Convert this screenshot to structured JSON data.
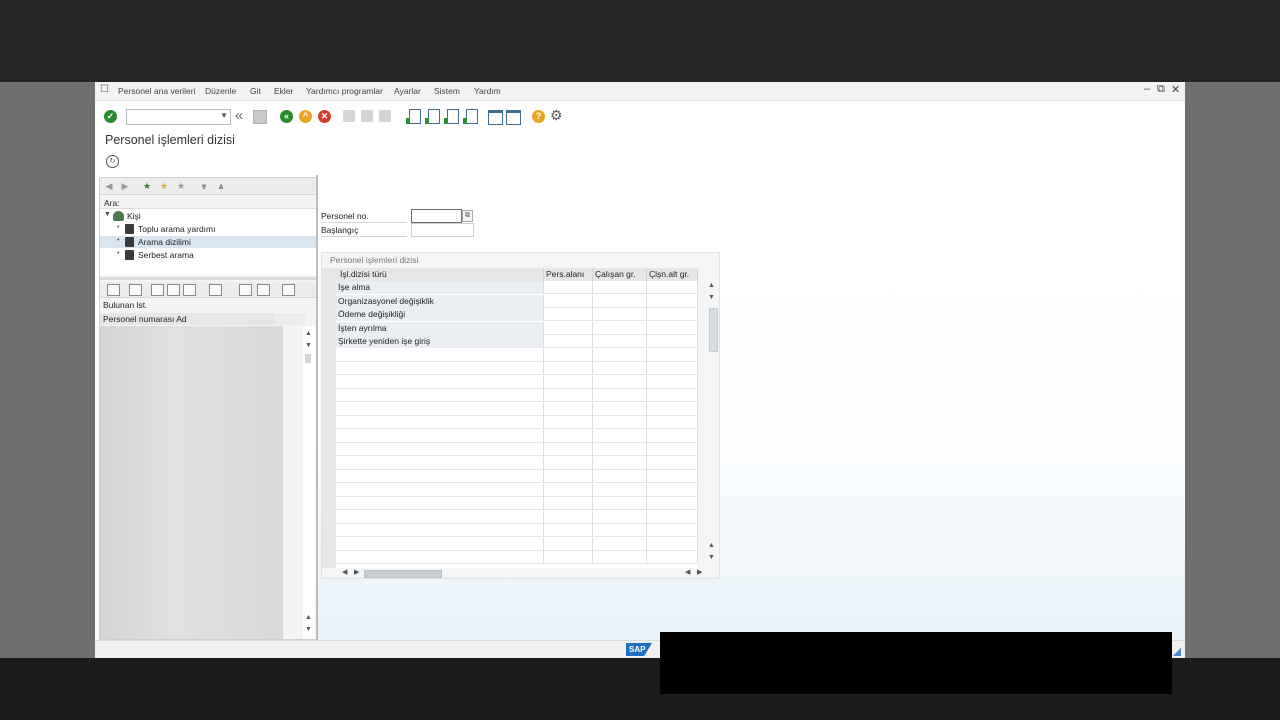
{
  "menu": {
    "items": [
      "Personel ana verileri",
      "Düzenle",
      "Git",
      "Ekler",
      "Yardımcı programlar",
      "Ayarlar",
      "Sistem",
      "Yardım"
    ]
  },
  "toolbar": {
    "command_value": "",
    "icons": [
      "enter-icon",
      "back-icon",
      "exit-icon",
      "cancel-icon",
      "print-icon",
      "find-icon",
      "find-next-icon",
      "first-page-icon",
      "previous-page-icon",
      "next-page-icon",
      "last-page-icon",
      "new-session-icon",
      "shortcut-icon",
      "help-icon",
      "customize-icon"
    ]
  },
  "page": {
    "title": "Personel işlemleri dizisi"
  },
  "left_panel": {
    "search_label": "Ara:",
    "tree": [
      {
        "label": "Kişi",
        "selected": false
      },
      {
        "label": "Toplu arama yardımı",
        "selected": false
      },
      {
        "label": "Arama dizilimi",
        "selected": true
      },
      {
        "label": "Serbest arama",
        "selected": false
      }
    ],
    "found_label": "Bulunan lst.",
    "result_header": "Personel numarası Ad"
  },
  "form": {
    "personnel_no_label": "Personel no.",
    "personnel_no_value": "",
    "start_label": "Başlangıç",
    "start_value": ""
  },
  "table": {
    "title": "Personel işlemleri dizisi",
    "columns": [
      "İşl.dizisi türü",
      "Pers.alanı",
      "Çalışan gr.",
      "Çlşn.alt gr."
    ],
    "rows": [
      "İşe alma",
      "Organizasyonel değişiklik",
      "Ödeme değişikliği",
      "İşten ayrılma",
      "Şirkette yeniden işe giriş"
    ],
    "empty_rows": 16
  },
  "status": {
    "logo": "SAP"
  },
  "colors": {
    "ok_green": "#2a8a2f",
    "back_green": "#2a8a2f",
    "exit_orange": "#e8a623",
    "cancel_red": "#d33c2c",
    "help_yellow": "#e8a623",
    "sap_blue": "#1f6fc5"
  }
}
